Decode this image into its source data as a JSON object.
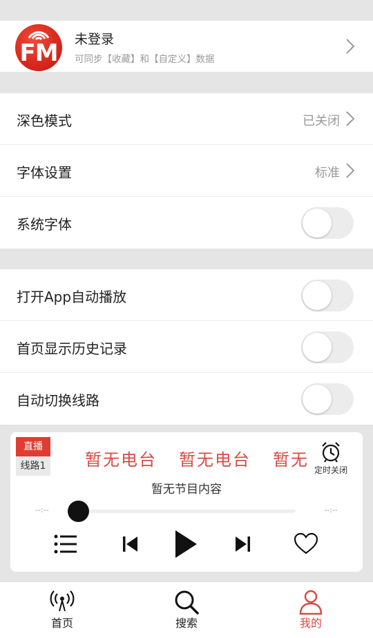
{
  "profile": {
    "logo_text": "FM",
    "name": "未登录",
    "subtitle": "可同步【收藏】和【自定义】数据"
  },
  "settings_group1": [
    {
      "label": "深色模式",
      "value": "已关闭",
      "control": "chevron"
    },
    {
      "label": "字体设置",
      "value": "标准",
      "control": "chevron"
    },
    {
      "label": "系统字体",
      "control": "toggle",
      "on": false
    }
  ],
  "settings_group2": [
    {
      "label": "打开App自动播放",
      "control": "toggle",
      "on": false
    },
    {
      "label": "首页显示历史记录",
      "control": "toggle",
      "on": false
    },
    {
      "label": "自动切换线路",
      "control": "toggle",
      "on": false
    }
  ],
  "player": {
    "badge_live": "直播",
    "badge_line": "线路1",
    "station_text": [
      "暂无电台",
      "暂无电台",
      "暂无电台"
    ],
    "timer_label": "定时关闭",
    "program": "暂无节目内容",
    "time_elapsed": "--:--",
    "time_total": "--:--",
    "progress": 0
  },
  "nav": [
    {
      "label": "首页",
      "icon": "radio-tower-icon",
      "active": false
    },
    {
      "label": "搜索",
      "icon": "search-icon",
      "active": false
    },
    {
      "label": "我的",
      "icon": "user-icon",
      "active": true
    }
  ],
  "colors": {
    "accent": "#d94a44",
    "live_badge": "#e03c31",
    "background": "#e5e5e5"
  }
}
